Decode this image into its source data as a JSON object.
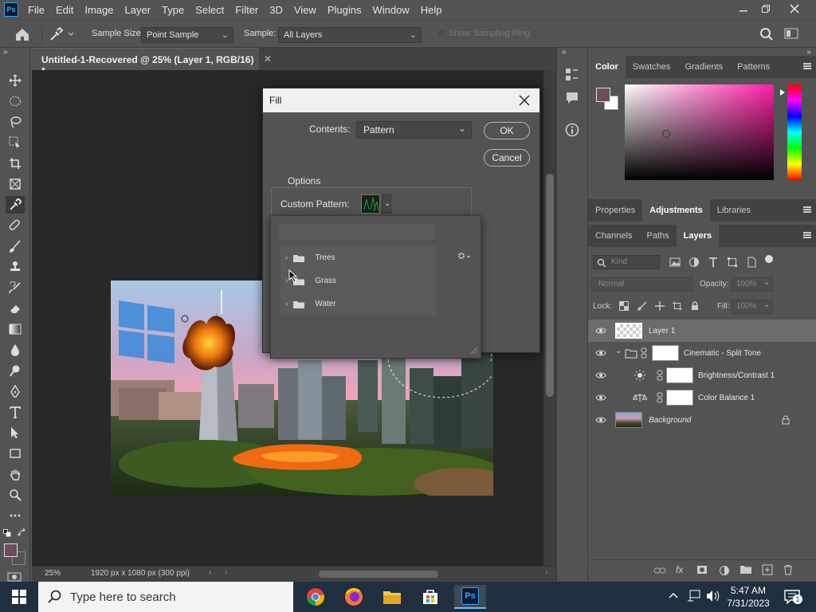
{
  "menubar": {
    "logo": "Ps",
    "items": [
      "File",
      "Edit",
      "Image",
      "Layer",
      "Type",
      "Select",
      "Filter",
      "3D",
      "View",
      "Plugins",
      "Window",
      "Help"
    ]
  },
  "options": {
    "sample_size_label": "Sample Size:",
    "sample_size_value": "Point Sample",
    "sample_label": "Sample:",
    "sample_value": "All Layers",
    "show_ring_label": "Show Sampling Ring"
  },
  "document": {
    "tab_title": "Untitled-1-Recovered @ 25% (Layer 1, RGB/16) *",
    "zoom": "25%",
    "dimensions": "1920 px x 1080 px (300 ppi)"
  },
  "fill_dialog": {
    "title": "Fill",
    "contents_label": "Contents:",
    "contents_value": "Pattern",
    "ok_label": "OK",
    "cancel_label": "Cancel",
    "options_label": "Options",
    "custom_pattern_label": "Custom Pattern:",
    "folders": [
      "Trees",
      "Grass",
      "Water"
    ]
  },
  "panels": {
    "color_tabs": [
      "Color",
      "Swatches",
      "Gradients",
      "Patterns"
    ],
    "props_tabs": [
      "Properties",
      "Adjustments",
      "Libraries"
    ],
    "layers_tabs": [
      "Channels",
      "Paths",
      "Layers"
    ],
    "kind_placeholder": "Kind",
    "blend_mode": "Normal",
    "opacity_label": "Opacity:",
    "opacity_value": "100%",
    "lock_label": "Lock:",
    "fill_label": "Fill:",
    "fill_value": "100%",
    "layers": [
      {
        "name": "Layer 1"
      },
      {
        "name": "Cinematic - Split Tone"
      },
      {
        "name": "Brightness/Contrast 1"
      },
      {
        "name": "Color Balance 1"
      },
      {
        "name": "Background"
      }
    ]
  },
  "colors": {
    "foreground": "#6e4d5f",
    "background": "#ffffff",
    "accent": "#31a8ff"
  },
  "taskbar": {
    "search_placeholder": "Type here to search",
    "time": "5:47 AM",
    "date": "7/31/2023"
  }
}
